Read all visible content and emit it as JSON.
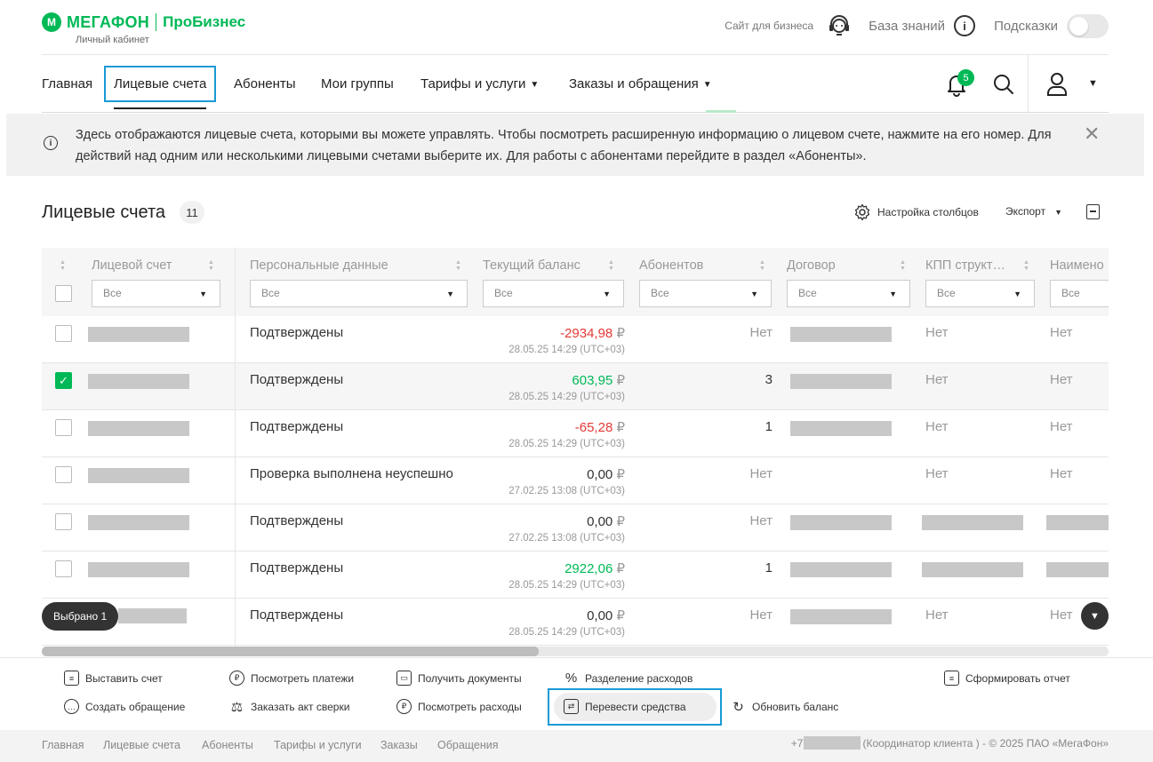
{
  "header": {
    "brand": "МЕГАФОН",
    "product": "ПроБизнес",
    "subtitle": "Личный кабинет",
    "business_site": "Сайт для бизнеса",
    "knowledge_base": "База знаний",
    "hints": "Подсказки"
  },
  "nav": {
    "items": [
      {
        "label": "Главная"
      },
      {
        "label": "Лицевые счета",
        "active": true
      },
      {
        "label": "Абоненты"
      },
      {
        "label": "Мои группы"
      },
      {
        "label": "Тарифы и услуги"
      },
      {
        "label": "Заказы и обращения"
      }
    ],
    "notifications_count": "5"
  },
  "banner": {
    "text": "Здесь отображаются лицевые счета, которыми вы можете управлять. Чтобы посмотреть расширенную информацию о лицевом счете, нажмите на его номер. Для действий над одним или несколькими лицевыми счетами выберите их. Для работы с абонентами перейдите в раздел «Абоненты»."
  },
  "page": {
    "title": "Лицевые счета",
    "count": "11",
    "column_settings": "Настройка столбцов",
    "export": "Экспорт"
  },
  "table": {
    "columns": [
      {
        "label": "Лицевой счет",
        "filter": "Все"
      },
      {
        "label": "Персональные данные",
        "filter": "Все"
      },
      {
        "label": "Текущий баланс",
        "filter": "Все"
      },
      {
        "label": "Абонентов",
        "filter": "Все"
      },
      {
        "label": "Договор",
        "filter": "Все"
      },
      {
        "label": "КПП структ…",
        "filter": "Все"
      },
      {
        "label": "Наимено",
        "filter": "Все"
      }
    ],
    "rows": [
      {
        "checked": false,
        "personal": "Подтверждены",
        "balance": "-2934,98",
        "currency": "₽",
        "sign": "neg",
        "date": "28.05.25 14:29 (UTC+03)",
        "subscribers": "Нет",
        "kpp": "Нет",
        "name": "Нет"
      },
      {
        "checked": true,
        "personal": "Подтверждены",
        "balance": "603,95",
        "currency": "₽",
        "sign": "pos",
        "date": "28.05.25 14:29 (UTC+03)",
        "subscribers": "3",
        "kpp": "Нет",
        "name": "Нет"
      },
      {
        "checked": false,
        "personal": "Подтверждены",
        "balance": "-65,28",
        "currency": "₽",
        "sign": "neg",
        "date": "28.05.25 14:29 (UTC+03)",
        "subscribers": "1",
        "kpp": "Нет",
        "name": "Нет"
      },
      {
        "checked": false,
        "personal": "Проверка выполнена неуспешно",
        "balance": "0,00",
        "currency": "₽",
        "sign": "zero",
        "date": "27.02.25 13:08 (UTC+03)",
        "subscribers": "Нет",
        "kpp": "Нет",
        "name": "Нет"
      },
      {
        "checked": false,
        "personal": "Подтверждены",
        "balance": "0,00",
        "currency": "₽",
        "sign": "zero",
        "date": "27.02.25 13:08 (UTC+03)",
        "subscribers": "Нет",
        "kpp": "",
        "name": ""
      },
      {
        "checked": false,
        "personal": "Подтверждены",
        "balance": "2922,06",
        "currency": "₽",
        "sign": "pos",
        "date": "28.05.25 14:29 (UTC+03)",
        "subscribers": "1",
        "kpp": "",
        "name": ""
      },
      {
        "checked": false,
        "personal": "Подтверждены",
        "balance": "0,00",
        "currency": "₽",
        "sign": "zero",
        "date": "28.05.25 14:29 (UTC+03)",
        "subscribers": "Нет",
        "kpp": "Нет",
        "name": "Нет"
      }
    ],
    "selected_label": "Выбрано 1"
  },
  "actions": {
    "issue_invoice": "Выставить счет",
    "view_payments": "Посмотреть платежи",
    "get_documents": "Получить документы",
    "split_expenses": "Разделение расходов",
    "create_report": "Сформировать отчет",
    "create_request": "Создать обращение",
    "order_reconciliation": "Заказать акт сверки",
    "view_expenses": "Посмотреть расходы",
    "transfer_funds": "Перевести средства",
    "refresh_balance": "Обновить баланс"
  },
  "footer": {
    "links": [
      "Главная",
      "Лицевые счета",
      "Абоненты",
      "Тарифы и услуги",
      "Заказы",
      "Обращения"
    ],
    "phone_prefix": "+7",
    "copyright": "(Координатор клиента ) - © 2025 ПАО «МегаФон»"
  },
  "colors": {
    "brand_green": "#00b956",
    "negative": "#e53935",
    "highlight": "#1a9ad6"
  }
}
